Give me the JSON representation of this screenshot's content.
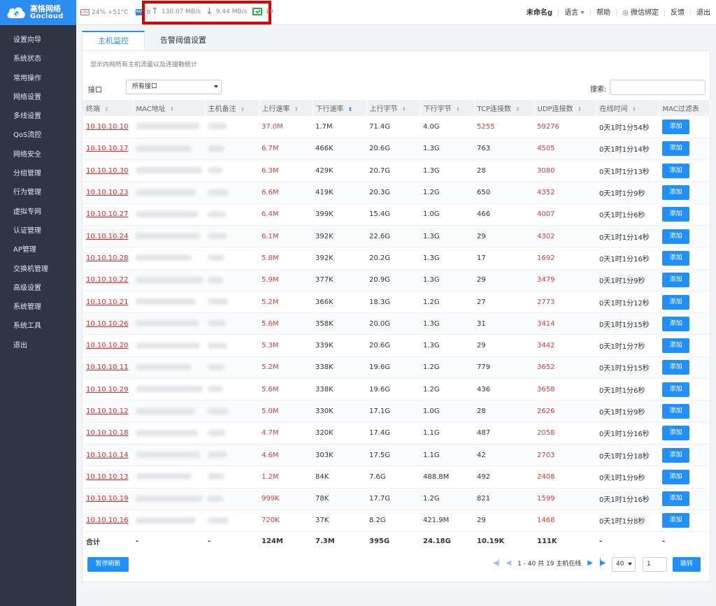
{
  "brand": {
    "name_cn": "高恪网络",
    "name_en": "Gocloud",
    "color": "#2d8cf0"
  },
  "sidebar": {
    "items": [
      {
        "label": "设置向导"
      },
      {
        "label": "系统状态"
      },
      {
        "label": "常用操作"
      },
      {
        "label": "网络设置"
      },
      {
        "label": "多线设置"
      },
      {
        "label": "QoS流控"
      },
      {
        "label": "网络安全"
      },
      {
        "label": "分组管理"
      },
      {
        "label": "行为管理"
      },
      {
        "label": "虚拟专网"
      },
      {
        "label": "认证管理"
      },
      {
        "label": "AP管理"
      },
      {
        "label": "交换机管理"
      },
      {
        "label": "高级设置"
      },
      {
        "label": "系统管理"
      },
      {
        "label": "系统工具"
      },
      {
        "label": "退出"
      }
    ]
  },
  "topbar": {
    "cpu_chip": "CPU",
    "cpu_stats": "24% +51°C",
    "ram_chip": "RAM",
    "ram_value": "8",
    "upload": "130.07 MB/s",
    "download": "9.44 MB/s",
    "online": "19",
    "user": "未命名g",
    "language": "语言",
    "help": "帮助",
    "wechat": "微信绑定",
    "feedback": "反馈",
    "logout": "退出"
  },
  "tabs": [
    {
      "label": "主机监控"
    },
    {
      "label": "告警阈值设置"
    }
  ],
  "panel": {
    "description": "显示内网所有主机流量以及连接数统计",
    "interface_label": "接口",
    "interface_value": "所有接口",
    "search_label": "搜索:",
    "search_value": ""
  },
  "table": {
    "headers": [
      "终端",
      "MAC地址",
      "主机备注",
      "上行速率",
      "下行速率",
      "上行字节",
      "下行字节",
      "TCP连接数",
      "UDP连接数",
      "在线时间",
      "MAC过滤表"
    ],
    "add_label": "添加",
    "rows": [
      {
        "ip": "10.10.10.10",
        "up": "37.0M",
        "down": "1.7M",
        "upb": "71.4G",
        "downb": "4.0G",
        "tcp": "5255",
        "udp": "59276",
        "time": "0天1时1分54秒"
      },
      {
        "ip": "10.10.10.17",
        "up": "6.7M",
        "down": "466K",
        "upb": "20.6G",
        "downb": "1.3G",
        "tcp": "763",
        "udp": "4505",
        "time": "0天1时1分14秒"
      },
      {
        "ip": "10.10.10.30",
        "up": "6.3M",
        "down": "429K",
        "upb": "20.7G",
        "downb": "1.3G",
        "tcp": "28",
        "udp": "3080",
        "time": "0天1时1分13秒"
      },
      {
        "ip": "10.10.10.23",
        "up": "6.6M",
        "down": "419K",
        "upb": "20.3G",
        "downb": "1.2G",
        "tcp": "650",
        "udp": "4352",
        "time": "0天1时1分9秒"
      },
      {
        "ip": "10.10.10.27",
        "up": "6.4M",
        "down": "399K",
        "upb": "15.4G",
        "downb": "1.0G",
        "tcp": "466",
        "udp": "4007",
        "time": "0天1时1分6秒"
      },
      {
        "ip": "10.10.10.24",
        "up": "6.1M",
        "down": "392K",
        "upb": "22.6G",
        "downb": "1.3G",
        "tcp": "29",
        "udp": "4302",
        "time": "0天1时1分14秒"
      },
      {
        "ip": "10.10.10.28",
        "up": "5.8M",
        "down": "392K",
        "upb": "20.2G",
        "downb": "1.3G",
        "tcp": "17",
        "udp": "1692",
        "time": "0天1时1分16秒"
      },
      {
        "ip": "10.10.10.22",
        "up": "5.9M",
        "down": "377K",
        "upb": "20.9G",
        "downb": "1.3G",
        "tcp": "29",
        "udp": "3479",
        "time": "0天1时1分9秒"
      },
      {
        "ip": "10.10.10.21",
        "up": "5.2M",
        "down": "366K",
        "upb": "18.3G",
        "downb": "1.2G",
        "tcp": "27",
        "udp": "2773",
        "time": "0天1时1分12秒"
      },
      {
        "ip": "10.10.10.26",
        "up": "5.6M",
        "down": "358K",
        "upb": "20.0G",
        "downb": "1.3G",
        "tcp": "31",
        "udp": "3414",
        "time": "0天1时1分15秒"
      },
      {
        "ip": "10.10.10.20",
        "up": "5.3M",
        "down": "339K",
        "upb": "20.6G",
        "downb": "1.3G",
        "tcp": "29",
        "udp": "3442",
        "time": "0天1时1分7秒"
      },
      {
        "ip": "10.10.10.11",
        "up": "5.2M",
        "down": "338K",
        "upb": "19.6G",
        "downb": "1.2G",
        "tcp": "779",
        "udp": "3652",
        "time": "0天1时1分15秒"
      },
      {
        "ip": "10.10.10.29",
        "up": "5.6M",
        "down": "338K",
        "upb": "19.6G",
        "downb": "1.2G",
        "tcp": "436",
        "udp": "3658",
        "time": "0天1时1分6秒"
      },
      {
        "ip": "10.10.10.12",
        "up": "5.0M",
        "down": "330K",
        "upb": "17.1G",
        "downb": "1.0G",
        "tcp": "28",
        "udp": "2626",
        "time": "0天1时1分9秒"
      },
      {
        "ip": "10.10.10.18",
        "up": "4.7M",
        "down": "320K",
        "upb": "17.4G",
        "downb": "1.1G",
        "tcp": "487",
        "udp": "2058",
        "time": "0天1时1分16秒"
      },
      {
        "ip": "10.10.10.14",
        "up": "4.6M",
        "down": "303K",
        "upb": "17.5G",
        "downb": "1.1G",
        "tcp": "42",
        "udp": "2703",
        "time": "0天1时1分18秒"
      },
      {
        "ip": "10.10.10.13",
        "up": "1.2M",
        "down": "84K",
        "upb": "7.6G",
        "downb": "488.8M",
        "tcp": "492",
        "udp": "2408",
        "time": "0天1时1分9秒"
      },
      {
        "ip": "10.10.10.19",
        "up": "999K",
        "down": "78K",
        "upb": "17.7G",
        "downb": "1.2G",
        "tcp": "821",
        "udp": "1599",
        "time": "0天1时1分16秒"
      },
      {
        "ip": "10.10.10.16",
        "up": "720K",
        "down": "37K",
        "upb": "8.2G",
        "downb": "421.9M",
        "tcp": "29",
        "udp": "1468",
        "time": "0天1时1分8秒"
      }
    ],
    "total": {
      "label": "合计",
      "mac": "-",
      "note": "-",
      "up": "124M",
      "down": "7.3M",
      "upb": "395G",
      "downb": "24.18G",
      "tcp": "10.19K",
      "udp": "111K",
      "time": "-",
      "filter": "-"
    }
  },
  "footer": {
    "pause_button": "暂停刷新",
    "page_info": "1 - 40 共 19 主机在线",
    "page_size": "40",
    "page_input": "1",
    "go_button": "跳转"
  }
}
